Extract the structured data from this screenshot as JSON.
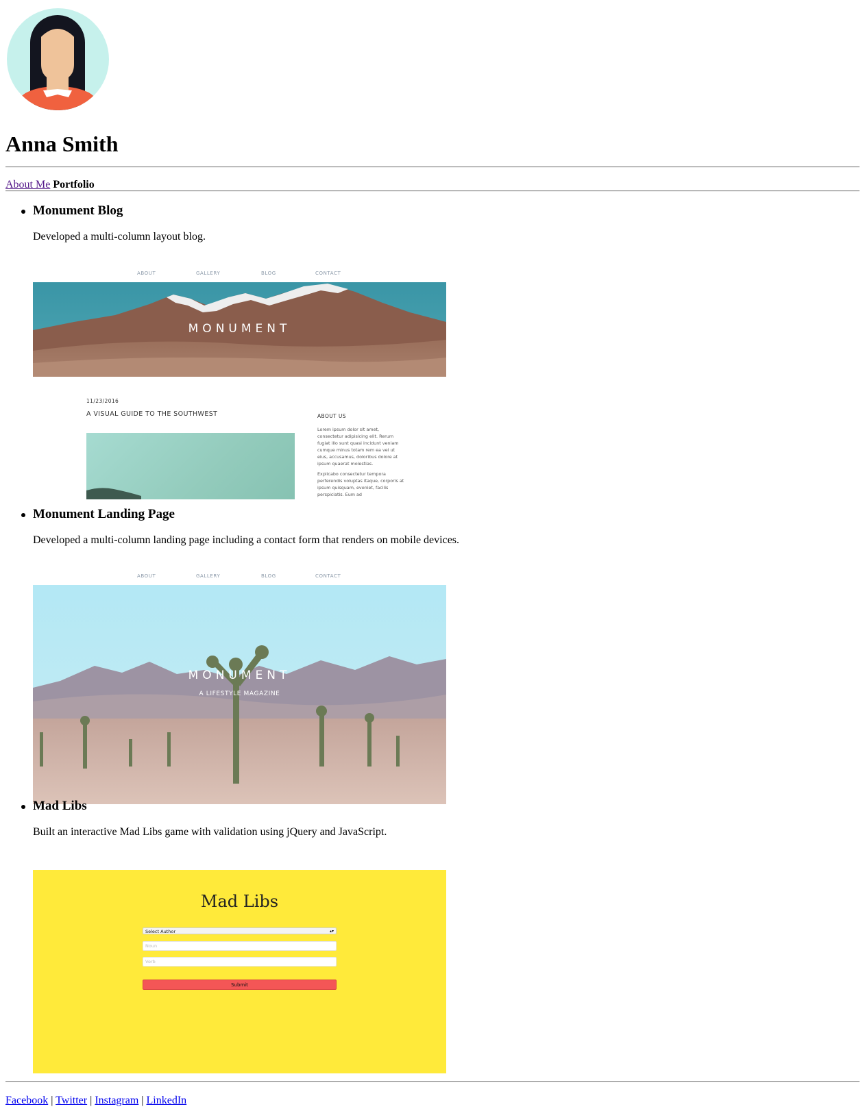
{
  "profile": {
    "name": "Anna Smith"
  },
  "nav": {
    "about_label": "About Me",
    "current_label": "Portfolio"
  },
  "projects": [
    {
      "title": "Monument Blog",
      "description": "Developed a multi-column layout blog.",
      "screenshot": {
        "nav": [
          "ABOUT",
          "GALLERY",
          "BLOG",
          "CONTACT"
        ],
        "banner_title": "MONUMENT",
        "post_date": "11/23/2016",
        "post_title": "A VISUAL GUIDE TO THE SOUTHWEST",
        "about_heading": "ABOUT US",
        "about_p1": "Lorem ipsum dolor sit amet, consectetur adipisicing elit. Rerum fugiat illo sunt quasi incidunt veniam cumque minus totam rem ea vel ut eius, accusamus, doloribus dolore at ipsum quaerat molestias.",
        "about_p2": "Explicabo consectetur tempora perferendis voluptas itaque, corporis at ipsum quisquam, eveniet, facilis perspiciatis. Eum ad"
      }
    },
    {
      "title": "Monument Landing Page",
      "description": "Developed a multi-column landing page including a contact form that renders on mobile devices.",
      "screenshot": {
        "nav": [
          "ABOUT",
          "GALLERY",
          "BLOG",
          "CONTACT"
        ],
        "hero_title": "MONUMENT",
        "hero_subtitle": "A LIFESTYLE MAGAZINE"
      }
    },
    {
      "title": "Mad Libs",
      "description": "Built an interactive Mad Libs game with validation using jQuery and JavaScript.",
      "screenshot": {
        "title": "Mad Libs",
        "select_label": "Select Author",
        "noun_placeholder": "Noun",
        "verb_placeholder": "Verb",
        "submit_label": "Submit"
      }
    }
  ],
  "footer": {
    "links": [
      "Facebook",
      "Twitter",
      "Instagram",
      "LinkedIn"
    ],
    "separator": "|"
  },
  "colors": {
    "link": "#0000ee",
    "visited_link": "#551a8b",
    "avatar_bg": "#c6f1ec",
    "mad_libs_bg": "#ffea3a",
    "mad_libs_button": "#f45656"
  }
}
